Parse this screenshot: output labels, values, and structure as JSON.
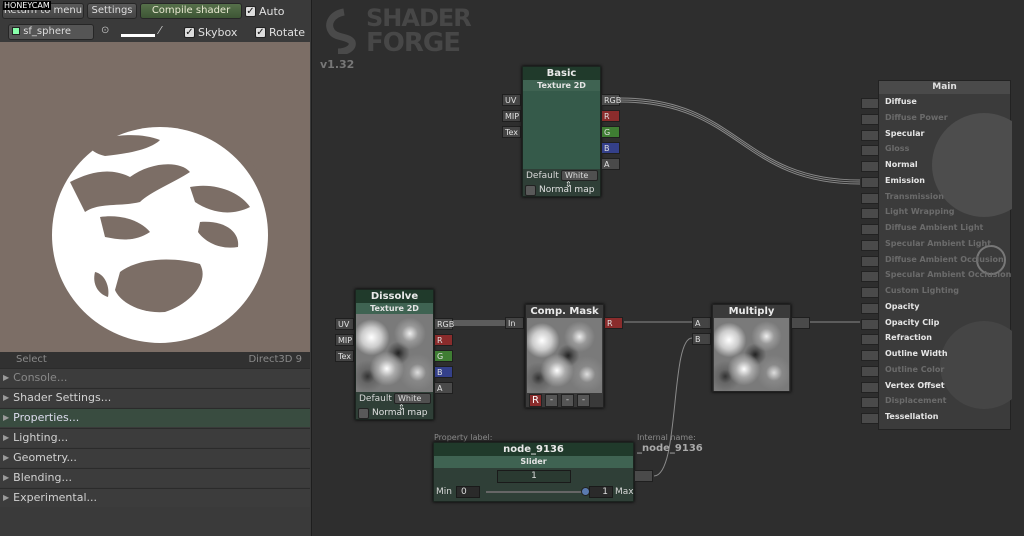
{
  "watermark": "HONEYCAM",
  "toolbar": {
    "return_label": "Return to menu",
    "settings_label": "Settings",
    "compile_label": "Compile shader",
    "auto_label": "Auto",
    "mesh_label": "sf_sphere",
    "skybox_label": "Skybox",
    "rotate_label": "Rotate"
  },
  "preview": {
    "select_label": "Select",
    "renderer_label": "Direct3D 9"
  },
  "sections": [
    "Console...",
    "Shader Settings...",
    "Properties...",
    "Lighting...",
    "Geometry...",
    "Blending...",
    "Experimental..."
  ],
  "logo": {
    "line1": "SHADER",
    "line2": "FORGE",
    "version": "v1.32"
  },
  "nodes": {
    "basic": {
      "title": "Basic",
      "type": "Texture 2D",
      "inputs": [
        "UV",
        "MIP",
        "Tex"
      ],
      "outputs": [
        "RGB",
        "R",
        "G",
        "B",
        "A"
      ],
      "default_label": "Default",
      "default_value": "White",
      "normal_map": "Normal map"
    },
    "dissolve": {
      "title": "Dissolve",
      "type": "Texture 2D",
      "inputs": [
        "UV",
        "MIP",
        "Tex"
      ],
      "outputs": [
        "RGB",
        "R",
        "G",
        "B",
        "A"
      ],
      "default_label": "Default",
      "default_value": "White",
      "normal_map": "Normal map"
    },
    "comp_mask": {
      "title": "Comp. Mask",
      "input": "In",
      "output": "R",
      "buttons": [
        "R",
        "-",
        "-",
        "-"
      ]
    },
    "multiply": {
      "title": "Multiply",
      "inputs": [
        "A",
        "B"
      ]
    },
    "slider": {
      "property_label": "Property label:",
      "internal_label": "Internal name:",
      "internal_name": "_node_9136",
      "title": "node_9136",
      "type": "Slider",
      "value": "1",
      "min_label": "Min",
      "min": "0",
      "max": "1",
      "max_label": "Max",
      "position": 1.0
    },
    "main": {
      "title": "Main",
      "inputs": [
        {
          "label": "Diffuse",
          "active": true
        },
        {
          "label": "Diffuse Power",
          "active": false
        },
        {
          "label": "Specular",
          "active": true
        },
        {
          "label": "Gloss",
          "active": false
        },
        {
          "label": "Normal",
          "active": true
        },
        {
          "label": "Emission",
          "active": true
        },
        {
          "label": "Transmission",
          "active": false
        },
        {
          "label": "Light Wrapping",
          "active": false
        },
        {
          "label": "Diffuse Ambient Light",
          "active": false
        },
        {
          "label": "Specular Ambient Light",
          "active": false
        },
        {
          "label": "Diffuse Ambient Occlusion",
          "active": false
        },
        {
          "label": "Specular Ambient Occlusion",
          "active": false
        },
        {
          "label": "Custom Lighting",
          "active": false
        },
        {
          "label": "Opacity",
          "active": true
        },
        {
          "label": "Opacity Clip",
          "active": true
        },
        {
          "label": "Refraction",
          "active": true
        },
        {
          "label": "Outline Width",
          "active": true
        },
        {
          "label": "Outline Color",
          "active": false
        },
        {
          "label": "Vertex Offset",
          "active": true
        },
        {
          "label": "Displacement",
          "active": false
        },
        {
          "label": "Tessellation",
          "active": true
        }
      ]
    }
  },
  "colors": {
    "accent_green": "#3f6352",
    "port_red": "#8a2c2c",
    "port_green": "#3f7d33",
    "port_blue": "#34408a",
    "preview_bg": "#7c6e66"
  }
}
